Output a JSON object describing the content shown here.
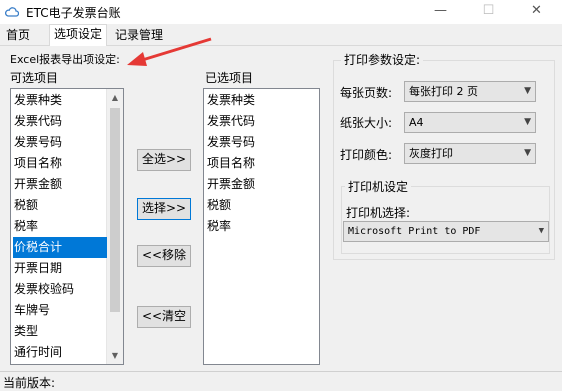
{
  "window": {
    "title": "ETC电子发票台账",
    "minimize": "—",
    "maximize": "☐",
    "close": "✕"
  },
  "tabs": [
    {
      "label": "首页"
    },
    {
      "label": "选项设定"
    },
    {
      "label": "记录管理"
    }
  ],
  "export_group": {
    "title": "Excel报表导出项设定:",
    "available_label": "可选项目",
    "selected_label": "已选项目",
    "available": [
      "发票种类",
      "发票代码",
      "发票号码",
      "项目名称",
      "开票金额",
      "税额",
      "税率",
      "价税合计",
      "开票日期",
      "发票校验码",
      "车牌号",
      "类型",
      "通行时间"
    ],
    "available_selected_index": 7,
    "selected": [
      "发票种类",
      "发票代码",
      "发票号码",
      "项目名称",
      "开票金额",
      "税额",
      "税率"
    ]
  },
  "buttons": {
    "select_all": "全选>>",
    "select": "选择>>",
    "remove": "<<移除",
    "clear": "<<清空"
  },
  "print_group": {
    "title": "打印参数设定:",
    "copies_label": "每张页数:",
    "copies_value": "每张打印 2 页",
    "size_label": "纸张大小:",
    "size_value": "A4",
    "color_label": "打印颜色:",
    "color_value": "灰度打印",
    "printer_title": "打印机设定",
    "printer_label": "打印机选择:",
    "printer_value": "Microsoft Print to PDF"
  },
  "status": {
    "version_label": "当前版本:"
  },
  "colors": {
    "selection": "#0078d7",
    "annotation_arrow": "#e53935"
  }
}
